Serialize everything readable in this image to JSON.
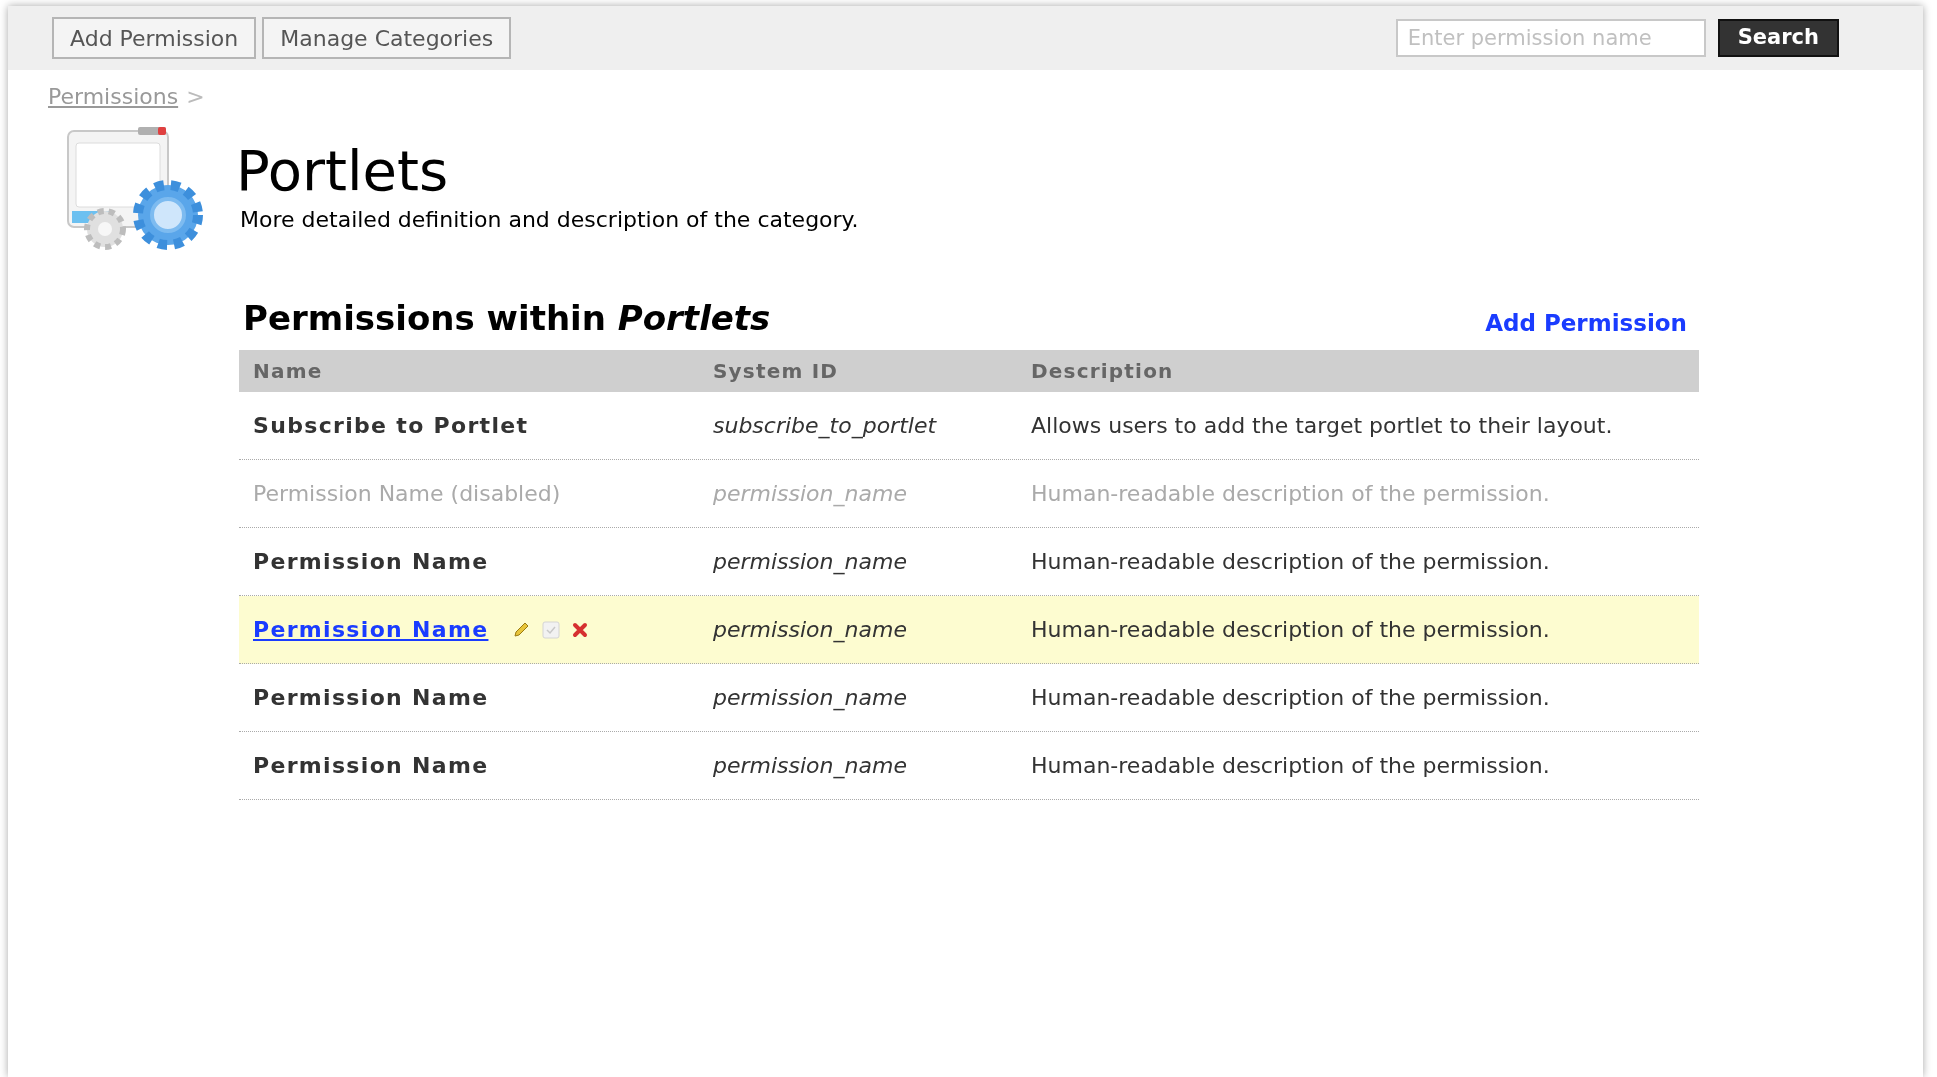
{
  "toolbar": {
    "buttons": [
      "Add Permission",
      "Manage Categories"
    ],
    "search": {
      "placeholder": "Enter permission name",
      "button": "Search"
    }
  },
  "breadcrumb": {
    "link": "Permissions",
    "separator": ">"
  },
  "category": {
    "title": "Portlets",
    "description": "More detailed definition and description of the category."
  },
  "section": {
    "title": "Permissions within *Portlets*",
    "action": "Add Permission"
  },
  "table": {
    "columns": [
      "Name",
      "System ID",
      "Description"
    ],
    "rows": [
      {
        "name": "Subscribe to Portlet",
        "system_id": "subscribe_to_portlet",
        "description": "Allows users to add the target portlet to their layout.",
        "disabled": false,
        "hovered": false
      },
      {
        "name": "Permission Name (disabled)",
        "system_id": "permission_name",
        "description": "Human-readable description of the permission.",
        "disabled": true,
        "hovered": false
      },
      {
        "name": "Permission Name",
        "system_id": "permission_name",
        "description": "Human-readable description of the permission.",
        "disabled": false,
        "hovered": false
      },
      {
        "name": "Permission Name",
        "system_id": "permission_name",
        "description": "Human-readable description of the permission.",
        "disabled": false,
        "hovered": true
      },
      {
        "name": "Permission Name",
        "system_id": "permission_name",
        "description": "Human-readable description of the permission.",
        "disabled": false,
        "hovered": false
      },
      {
        "name": "Permission Name",
        "system_id": "permission_name",
        "description": "Human-readable description of the permission.",
        "disabled": false,
        "hovered": false
      }
    ]
  }
}
